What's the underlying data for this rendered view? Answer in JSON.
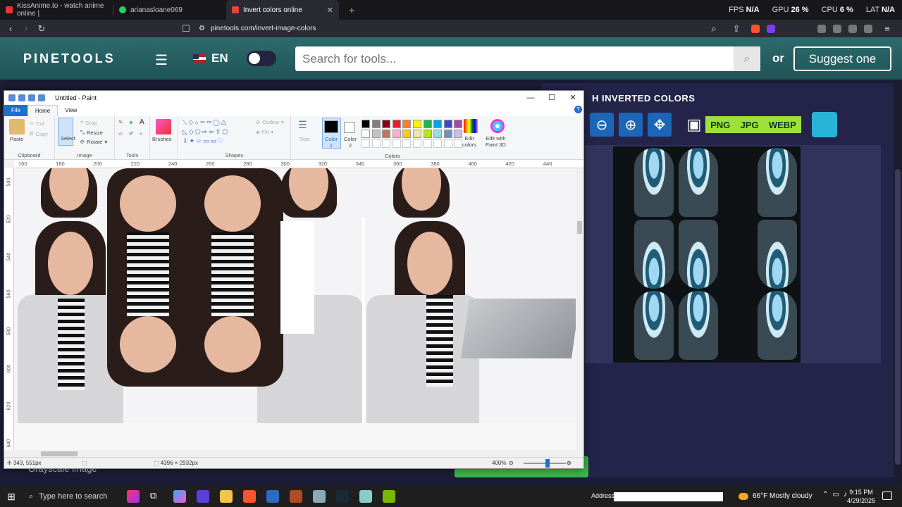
{
  "browser": {
    "tabs": [
      {
        "label": "KissAnime.to - watch anime online |",
        "active": false,
        "color": "#e33"
      },
      {
        "label": "arianasloane069",
        "active": false,
        "color": "#2bd15f"
      },
      {
        "label": "Invert colors online",
        "active": true,
        "color": "#ef3f3f"
      }
    ],
    "url": "pinetools.com/invert-image-colors",
    "perf": {
      "fps_label": "FPS",
      "fps_value": "N/A",
      "gpu_label": "GPU",
      "gpu_value": "26 %",
      "cpu_label": "CPU",
      "cpu_value": "6 %",
      "lat_label": "LAT",
      "lat_value": "N/A"
    }
  },
  "site": {
    "logo": "PINETOOLS",
    "lang": "EN",
    "search_placeholder": "Search for tools...",
    "or_text": "or",
    "suggest_label": "Suggest one",
    "panel_title": "H INVERTED COLORS",
    "formats": [
      "PNG",
      "JPG",
      "WEBP"
    ],
    "left_text": "Grayscale image",
    "colors": {
      "header": "#2e6b6e",
      "format_bar": "#9ee03b",
      "tool_icon": "#1b66b8"
    }
  },
  "paint": {
    "title": "Untitled - Paint",
    "tabs": [
      "File",
      "Home",
      "View"
    ],
    "clipboard": {
      "paste": "Paste",
      "cut": "Cut",
      "copy": "Copy",
      "label": "Clipboard"
    },
    "image": {
      "select": "Select",
      "crop": "Crop",
      "resize": "Resize",
      "rotate": "Rotate",
      "label": "Image"
    },
    "tools": {
      "label": "Tools",
      "text": "A"
    },
    "brushes": "Brushes",
    "shapes": {
      "outline": "Outline",
      "fill": "Fill",
      "label": "Shapes"
    },
    "size": "Size",
    "color1_label": "Color\n1",
    "color2_label": "Color\n2",
    "colors_label": "Colors",
    "edit_colors": "Edit\ncolors",
    "edit_3d": "Edit with\nPaint 3D",
    "palette": [
      "#000000",
      "#7f7f7f",
      "#880015",
      "#ed1c24",
      "#ff7f27",
      "#fff200",
      "#22b14c",
      "#00a2e8",
      "#3f48cc",
      "#a349a4",
      "#ffffff",
      "#c3c3c3",
      "#b97a57",
      "#ffaec9",
      "#ffc90e",
      "#efe4b0",
      "#b5e61d",
      "#99d9ea",
      "#7092be",
      "#c8bfe7"
    ],
    "ruler_h": [
      "160",
      "180",
      "200",
      "220",
      "240",
      "260",
      "280",
      "300",
      "320",
      "340",
      "360",
      "380",
      "400",
      "420",
      "440"
    ],
    "ruler_v": [
      "500",
      "520",
      "540",
      "560",
      "580",
      "600",
      "620",
      "640"
    ],
    "status": {
      "cursor": "343, 551px",
      "size": "4396 × 2932px",
      "zoom": "400%"
    }
  },
  "taskbar": {
    "search_placeholder": "Type here to search",
    "address_label": "Address",
    "weather": "66°F  Mostly cloudy",
    "time": "9:15 PM",
    "date": "4/29/2025"
  }
}
